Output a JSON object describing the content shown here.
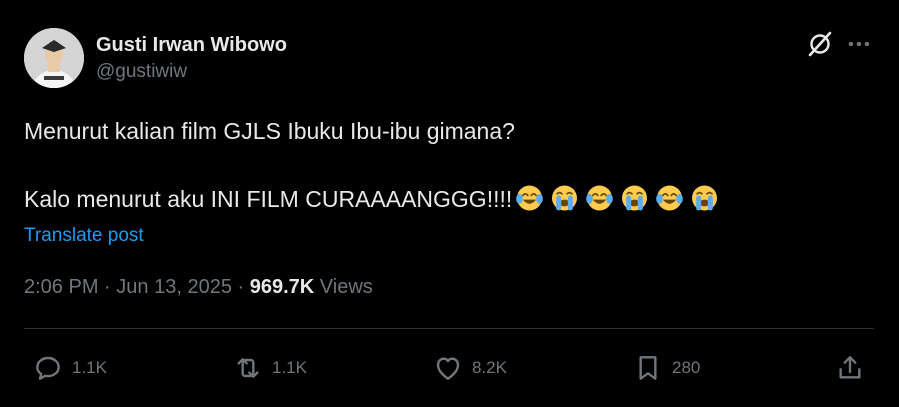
{
  "author": {
    "display_name": "Gusti Irwan Wibowo",
    "handle": "@gustiwiw"
  },
  "header_icons": [
    "grok-icon",
    "more-icon"
  ],
  "tweet": {
    "line1": "Menurut kalian film GJLS Ibuku Ibu-ibu gimana?",
    "line2": "Kalo menurut aku INI FILM CURAAAANGGG!!!!",
    "emojis": [
      "face-with-tears-of-joy",
      "loudly-crying-face",
      "face-with-tears-of-joy",
      "loudly-crying-face",
      "face-with-tears-of-joy",
      "loudly-crying-face"
    ]
  },
  "translate_label": "Translate post",
  "meta": {
    "time": "2:06 PM",
    "separator": "·",
    "date": "Jun 13, 2025",
    "views_count": "969.7K",
    "views_label": "Views"
  },
  "actions": {
    "replies": "1.1K",
    "reposts": "1.1K",
    "likes": "8.2K",
    "bookmarks": "280"
  },
  "colors": {
    "background": "#000000",
    "text": "#e7e9ea",
    "secondary": "#71767b",
    "link": "#1d9bf0",
    "divider": "#2f3336"
  }
}
